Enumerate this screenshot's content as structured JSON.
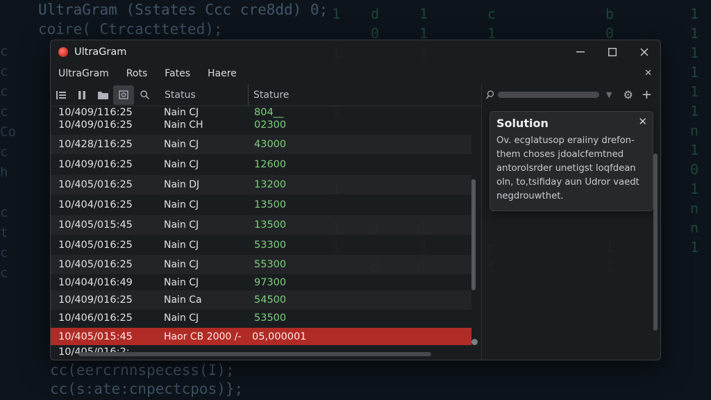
{
  "background": {
    "code_top": [
      "UltraGram (Sstates Ccc cre8dd) 0;",
      "coire( Ctrcactteted);"
    ],
    "code_bottom": [
      "cc(eercrnnspecess(I);",
      "cc(s:ate:cnpectcpos)};"
    ],
    "rain_columns": [
      "1\n\n1\n\n\n1\n\n\n\n1\n\n1\n1",
      "d\n0\n\n\n\n\n\n\n\n\n\nd\n\nd",
      "1\n1\n1\n\n\n\n\n\n\n\n\n1\n1\n1",
      "c\n1\n\n\n\n\n\n\n\n\n\n\nc\nt",
      "b\n0\n1\n\n\n\n\n\n\n\n\n\n1\n1",
      "1\n1\n1\n1\n1\n1\nn\n1\n0\n1\nn\nn\n1"
    ],
    "left_code": "c\nc\nc\nc\nCo\nc\nh\n\nc\nt\nc\nc"
  },
  "window": {
    "title": "UltraGram",
    "controls": {
      "minimize": "—",
      "maximize": "☐",
      "close": "✕"
    }
  },
  "menu": {
    "items": [
      "UltraGram",
      "Rots",
      "Fates",
      "Haere"
    ],
    "close": "✕"
  },
  "toolbar": {
    "columns": {
      "status": "Status",
      "stature": "Stature"
    }
  },
  "table": {
    "rows": [
      {
        "time": "10/409/116:25",
        "name": "Nain CJ",
        "value": "804__"
      },
      {
        "time": "10/409/016:25",
        "name": "Nain CH",
        "value": "02300"
      },
      {
        "time": "10/428/116:25",
        "name": "Nain CJ",
        "value": "43000"
      },
      {
        "time": "10/409/016:25",
        "name": "Nain CJ",
        "value": "12600"
      },
      {
        "time": "10/405/016:25",
        "name": "Nain DJ",
        "value": "13200"
      },
      {
        "time": "10/404/016:25",
        "name": "Nain CJ",
        "value": "13500"
      },
      {
        "time": "10/405/015:45",
        "name": "Nain CJ",
        "value": "13500"
      },
      {
        "time": "10/405/016:25",
        "name": "Nain CJ",
        "value": "53300"
      },
      {
        "time": "10/405/016:25",
        "name": "Nain CJ",
        "value": "55300"
      },
      {
        "time": "10/404/016:49",
        "name": "Nain CJ",
        "value": "97300"
      },
      {
        "time": "10/409/016:25",
        "name": "Nain Ca",
        "value": "54500"
      },
      {
        "time": "10/406/016:25",
        "name": "Nain CJ",
        "value": "53500"
      },
      {
        "time": "10/405/015:45",
        "name": "Haor CB 2000 /-",
        "value": "05,000001",
        "selected": true
      },
      {
        "time": "10/405/016:2:",
        "name": "",
        "value": ""
      }
    ]
  },
  "solution": {
    "title": "Solution",
    "close": "✕",
    "lines": [
      "Ov. ecglatusop eraiiny drefon-",
      "them choses jdoalcfemtned",
      "antorolsrder unetigst loqfdean",
      "oln, to,tsifiday aun Udror vaedt",
      "negdrouwthet."
    ]
  },
  "colors": {
    "accent_selection": "#b02b26",
    "value_green": "#7fd07c",
    "app_icon": "#d9382c"
  }
}
